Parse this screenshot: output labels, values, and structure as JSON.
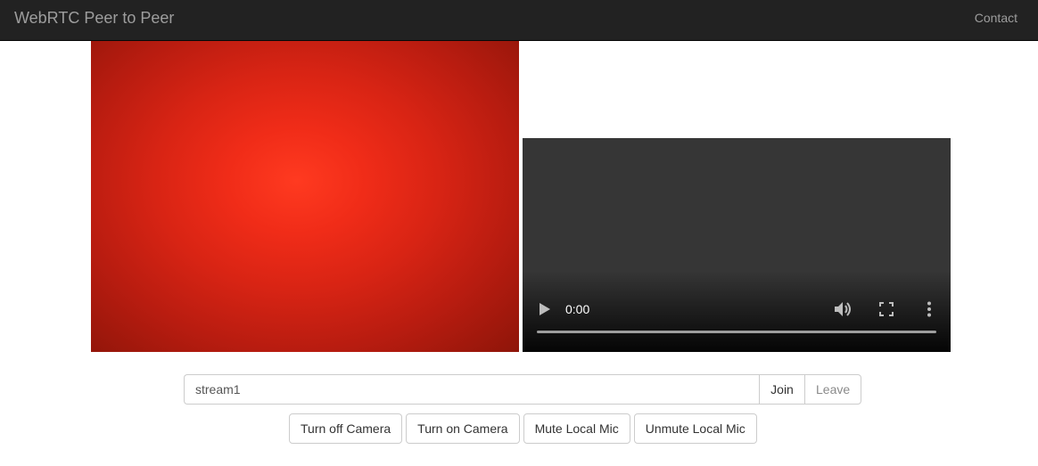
{
  "navbar": {
    "brand": "WebRTC Peer to Peer",
    "links": [
      "Contact"
    ],
    "background": "#222222"
  },
  "local_video": {
    "dominant_color": "#e42a16"
  },
  "remote_video": {
    "time": "0:00",
    "controls": [
      "play-icon",
      "volume-icon",
      "fullscreen-icon",
      "more-vert-icon"
    ]
  },
  "stream": {
    "input_value": "stream1",
    "join_label": "Join",
    "leave_label": "Leave"
  },
  "media_controls": {
    "turn_off_camera": "Turn off Camera",
    "turn_on_camera": "Turn on Camera",
    "mute_local_mic": "Mute Local Mic",
    "unmute_local_mic": "Unmute Local Mic"
  }
}
